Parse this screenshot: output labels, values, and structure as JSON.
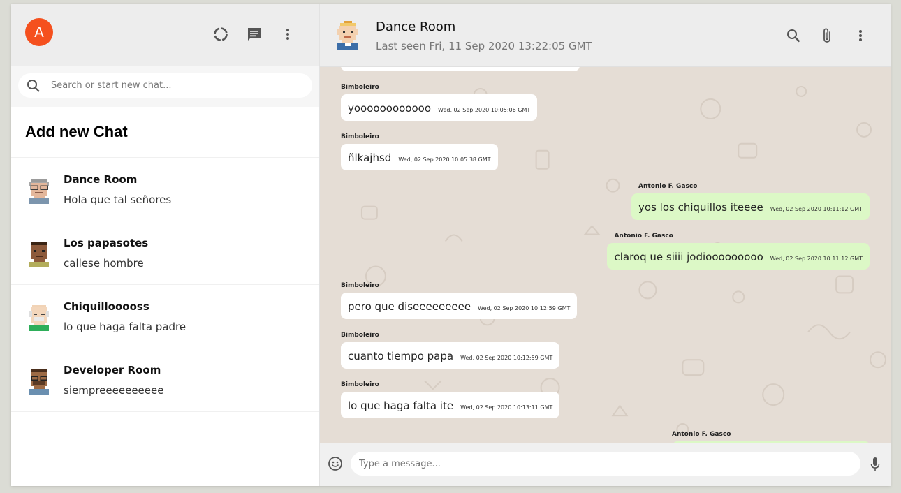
{
  "me": {
    "avatar_letter": "A",
    "avatar_color": "#f5501e"
  },
  "sidebar": {
    "icons": [
      "status-icon",
      "new-chat-icon",
      "menu-icon"
    ],
    "search_placeholder": "Search or start new chat...",
    "add_new_chat": "Add new Chat",
    "chats": [
      {
        "name": "Dance Room",
        "last_message": "Hola que tal señores",
        "avatar": "grey-hair-glasses-avatar"
      },
      {
        "name": "Los papasotes",
        "last_message": "callese hombre",
        "avatar": "dark-skin-avatar"
      },
      {
        "name": "Chiquillooooss",
        "last_message": "lo que haga falta padre",
        "avatar": "bald-old-man-avatar"
      },
      {
        "name": "Developer Room",
        "last_message": "siempreeeeeeeeee",
        "avatar": "dark-skin-glasses-avatar"
      }
    ]
  },
  "chat": {
    "title": "Dance Room",
    "subtitle": "Last seen Fri, 11 Sep 2020 13:22:05 GMT",
    "header_icons": [
      "search-icon",
      "attach-icon",
      "menu-icon"
    ],
    "messages": [
      {
        "sender": "Bimboleiro",
        "text": "yoooooooooooo",
        "time": "Wed, 02 Sep 2020 10:05:06 GMT",
        "mine": false
      },
      {
        "sender": "Bimboleiro",
        "text": "ñlkajhsd",
        "time": "Wed, 02 Sep 2020 10:05:38 GMT",
        "mine": false
      },
      {
        "sender": "Antonio F. Gasco",
        "text": "yos los chiquillos iteeee",
        "time": "Wed, 02 Sep 2020 10:11:12 GMT",
        "mine": true
      },
      {
        "sender": "Antonio F. Gasco",
        "text": "claroq ue siiii jodiooooooooo",
        "time": "Wed, 02 Sep 2020 10:11:12 GMT",
        "mine": true
      },
      {
        "sender": "Bimboleiro",
        "text": "pero que diseeeeeeeee",
        "time": "Wed, 02 Sep 2020 10:12:59 GMT",
        "mine": false
      },
      {
        "sender": "Bimboleiro",
        "text": "cuanto tiempo papa",
        "time": "Wed, 02 Sep 2020 10:12:59 GMT",
        "mine": false
      },
      {
        "sender": "Bimboleiro",
        "text": "lo que haga falta ite",
        "time": "Wed, 02 Sep 2020 10:13:11 GMT",
        "mine": false
      },
      {
        "sender": "Antonio F. Gasco",
        "text": "",
        "time": "",
        "mine": true
      }
    ],
    "composer_placeholder": "Type a message...",
    "colors": {
      "incoming": "#ffffff",
      "outgoing": "#dcf8c6",
      "wallpaper": "#e5ddd5"
    }
  }
}
